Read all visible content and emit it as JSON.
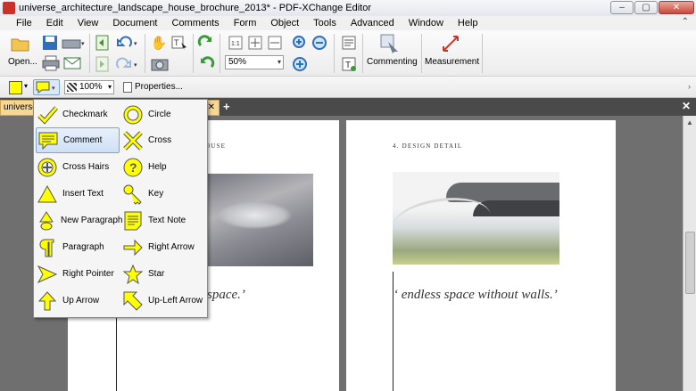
{
  "window": {
    "title": "universe_architecture_landscape_house_brochure_2013* - PDF-XChange Editor"
  },
  "menu": [
    "File",
    "Edit",
    "View",
    "Document",
    "Comments",
    "Form",
    "Object",
    "Tools",
    "Advanced",
    "Window",
    "Help"
  ],
  "toolbar": {
    "open_label": "Open...",
    "zoom_value": "50%",
    "commenting_label": "Commenting",
    "measurement_label": "Measurement"
  },
  "toolbar2": {
    "opacity_value": "100%",
    "properties_label": "Properties..."
  },
  "tab": {
    "label": "universe"
  },
  "dropdown": {
    "items": [
      {
        "label": "Checkmark",
        "icon": "checkmark-icon"
      },
      {
        "label": "Circle",
        "icon": "circle-icon"
      },
      {
        "label": "Comment",
        "icon": "comment-icon"
      },
      {
        "label": "Cross",
        "icon": "cross-icon"
      },
      {
        "label": "Cross Hairs",
        "icon": "cross-hairs-icon"
      },
      {
        "label": "Help",
        "icon": "help-icon"
      },
      {
        "label": "Insert Text",
        "icon": "insert-text-icon"
      },
      {
        "label": "Key",
        "icon": "key-icon"
      },
      {
        "label": "New Paragraph",
        "icon": "new-paragraph-icon"
      },
      {
        "label": "Text Note",
        "icon": "text-note-icon"
      },
      {
        "label": "Paragraph",
        "icon": "paragraph-icon"
      },
      {
        "label": "Right Arrow",
        "icon": "right-arrow-icon"
      },
      {
        "label": "Right Pointer",
        "icon": "right-pointer-icon"
      },
      {
        "label": "Star",
        "icon": "star-icon"
      },
      {
        "label": "Up Arrow",
        "icon": "up-arrow-icon"
      },
      {
        "label": "Up-Left Arrow",
        "icon": "up-left-arrow-icon"
      }
    ]
  },
  "pages": {
    "left_heading": "OUSE",
    "left_quote": "space.’",
    "right_heading": "4.  DESIGN DETAIL",
    "right_quote": "‘ endless space without walls.’"
  },
  "colors": {
    "note_yellow": "#ffff00",
    "tab_orange": "#f7d794",
    "selection_blue": "#cfe0f5"
  }
}
